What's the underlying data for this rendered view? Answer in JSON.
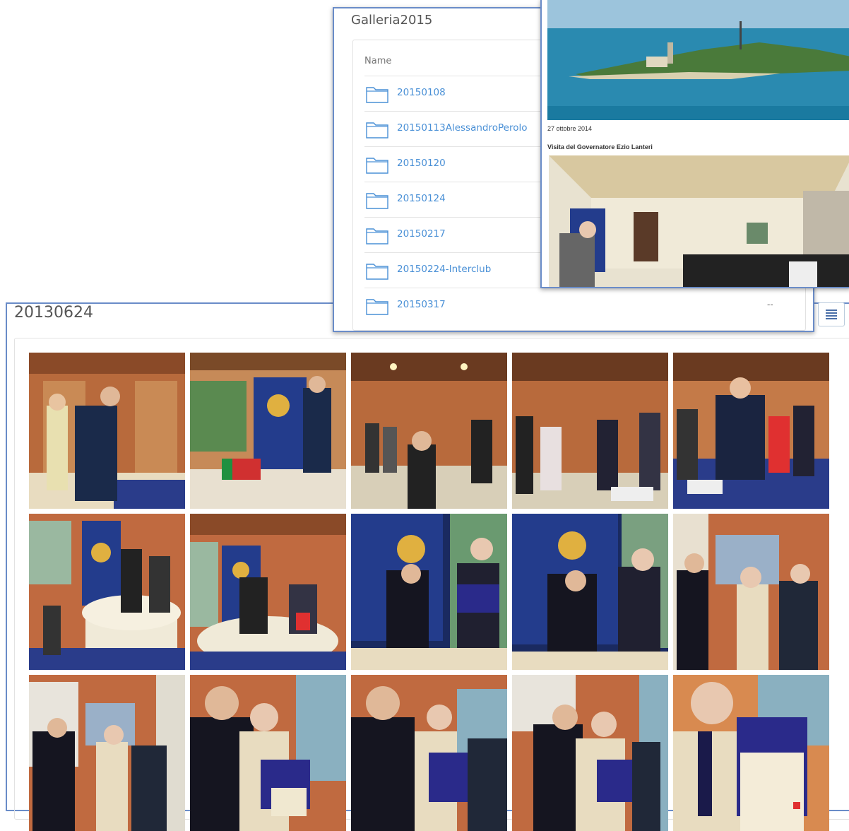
{
  "gallery": {
    "title": "20130624",
    "toggle_icon": "list-view-icon",
    "photos": [
      {
        "label": "photo-1"
      },
      {
        "label": "photo-2"
      },
      {
        "label": "photo-3"
      },
      {
        "label": "photo-4"
      },
      {
        "label": "photo-5"
      },
      {
        "label": "photo-6"
      },
      {
        "label": "photo-7"
      },
      {
        "label": "photo-8"
      },
      {
        "label": "photo-9"
      },
      {
        "label": "photo-10"
      },
      {
        "label": "photo-11"
      },
      {
        "label": "photo-12"
      },
      {
        "label": "photo-13"
      },
      {
        "label": "photo-14"
      },
      {
        "label": "photo-15"
      }
    ]
  },
  "folders": {
    "title": "Galleria2015",
    "column_header": "Name",
    "items": [
      {
        "name": "20150108"
      },
      {
        "name": "20150113AlessandroPerolo"
      },
      {
        "name": "20150120"
      },
      {
        "name": "20150124"
      },
      {
        "name": "20150217"
      },
      {
        "name": "20150224-Interclub"
      },
      {
        "name": "20150317",
        "size": "--"
      }
    ]
  },
  "news": {
    "date": "27 ottobre 2014",
    "caption": "Visita del Governatore Ezio Lanteri"
  },
  "colors": {
    "border": "#6a8cc8",
    "link": "#4a90d6",
    "banner_blue": "#233c8c",
    "wall_orange": "#b8643a"
  }
}
